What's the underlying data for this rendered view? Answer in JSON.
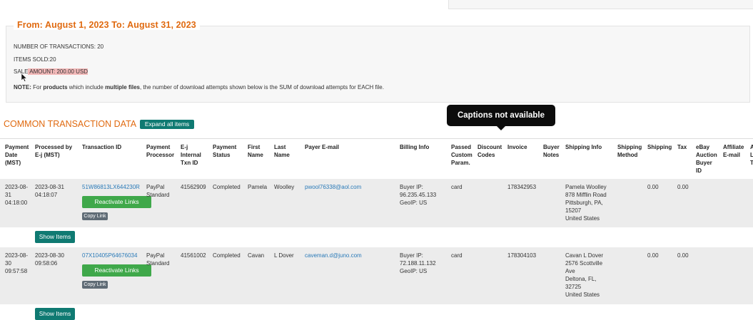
{
  "summary": {
    "title": "From: August 1, 2023 To: August 31, 2023",
    "transactions": "NUMBER OF TRANSACTIONS: 20",
    "items_sold": "ITEMS SOLD:20",
    "sale_prefix": "SALE",
    "sale_highlight": " AMOUNT: 200.00 USD",
    "note_label": "NOTE:",
    "note_t1": " For ",
    "note_b1": "products",
    "note_t2": " which include ",
    "note_b2": "multiple files",
    "note_t3": ", the number of download attempts shown below is the SUM of download attempts for EACH file."
  },
  "section": {
    "title": "COMMON TRANSACTION DATA",
    "expand_label": "Expand all items"
  },
  "tooltip": {
    "text": "Captions not available"
  },
  "headers": {
    "payment_date": [
      "Payment",
      "Date",
      "(MST)"
    ],
    "processed_by": [
      "Processed by",
      "E-j (MST)"
    ],
    "transaction_id": [
      "Transaction ID"
    ],
    "payment_processor": [
      "Payment",
      "Processor"
    ],
    "internal_id": [
      "E-j",
      "Internal",
      "Txn ID"
    ],
    "payment_status": [
      "Payment",
      "Status"
    ],
    "first_name": [
      "First",
      "Name"
    ],
    "last_name": [
      "Last",
      "Name"
    ],
    "payer_email": [
      "Payer E-mail"
    ],
    "billing_info": [
      "Billing Info"
    ],
    "passed_custom": [
      "Passed",
      "Custom",
      "Param."
    ],
    "discount_codes": [
      "Discount",
      "Codes"
    ],
    "invoice": [
      "Invoice"
    ],
    "buyer_notes": [
      "Buyer",
      "Notes"
    ],
    "shipping_info": [
      "Shipping Info"
    ],
    "shipping_method": [
      "Shipping",
      "Method"
    ],
    "shipping": [
      "Shipping"
    ],
    "tax": [
      "Tax"
    ],
    "ebay": [
      "eBay",
      "Auction",
      "Buyer",
      "ID"
    ],
    "affiliate": [
      "Affiliate",
      "E-mail"
    ],
    "extra": [
      "A",
      "L",
      "T"
    ]
  },
  "rows": [
    {
      "payment_date": [
        "2023-08-",
        "31",
        "04:18:00"
      ],
      "processed": [
        "2023-08-31",
        "04:18:07"
      ],
      "txn_id": "51W86813LX644230R",
      "reactivate": "Reactivate Links",
      "copy": "Copy Link",
      "processor": [
        "PayPal",
        "Standard"
      ],
      "internal_id": "41562909",
      "status": "Completed",
      "first": "Pamela",
      "last": "Woolley",
      "email": "pwool76338@aol.com",
      "billing": [
        "Buyer IP:",
        "96.235.45.133",
        "GeoIP: US"
      ],
      "custom": "card",
      "invoice": "178342953",
      "shipping_info": [
        "Pamela Woolley",
        "878 Mifflin Road",
        "Pittsburgh, PA,",
        "15207",
        "United States"
      ],
      "shipping": "0.00",
      "tax": "0.00",
      "show_items": "Show Items"
    },
    {
      "payment_date": [
        "2023-08-",
        "30",
        "09:57:58"
      ],
      "processed": [
        "2023-08-30",
        "09:58:06"
      ],
      "txn_id": "07X10405P64676034",
      "reactivate": "Reactivate Links",
      "copy": "Copy Link",
      "processor": [
        "PayPal",
        "Standard"
      ],
      "internal_id": "41561002",
      "status": "Completed",
      "first": "Cavan",
      "last": "L Dover",
      "email": "caveman.d@juno.com",
      "billing": [
        "Buyer IP:",
        "72.188.11.132",
        "GeoIP: US"
      ],
      "custom": "card",
      "invoice": "178304103",
      "shipping_info": [
        "Cavan L Dover",
        "2576 Scottville",
        "Ave",
        "Deltona, FL,",
        "32725",
        "United States"
      ],
      "shipping": "0.00",
      "tax": "0.00",
      "show_items": "Show Items"
    }
  ],
  "colors": {
    "accent": "#e06a10",
    "teal": "#0f7a72",
    "green": "#3fa84a",
    "link": "#2a7ab8",
    "highlight": "#f3b9b9"
  }
}
